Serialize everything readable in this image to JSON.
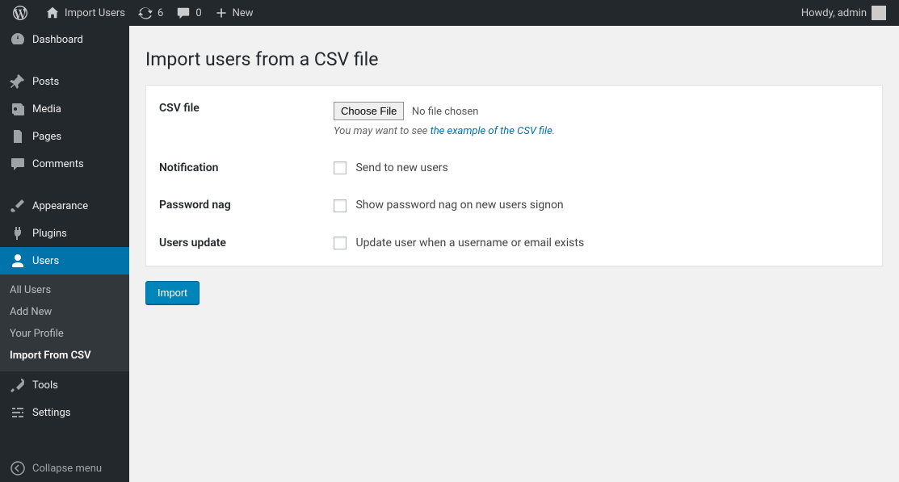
{
  "adminbar": {
    "site_title": "Import Users",
    "updates_count": "6",
    "comments_count": "0",
    "new_label": "New",
    "howdy": "Howdy, admin"
  },
  "sidebar": {
    "items": {
      "dashboard": "Dashboard",
      "posts": "Posts",
      "media": "Media",
      "pages": "Pages",
      "comments": "Comments",
      "appearance": "Appearance",
      "plugins": "Plugins",
      "users": "Users",
      "tools": "Tools",
      "settings": "Settings"
    },
    "users_submenu": {
      "all": "All Users",
      "add": "Add New",
      "profile": "Your Profile",
      "import": "Import From CSV"
    },
    "collapse": "Collapse menu"
  },
  "page": {
    "title": "Import users from a CSV file",
    "rows": {
      "csv_label": "CSV file",
      "choose_file": "Choose File",
      "no_file": "No file chosen",
      "help_prefix": "You may want to see ",
      "help_link": "the example of the CSV file",
      "help_suffix": ".",
      "notification_label": "Notification",
      "notification_check": "Send to new users",
      "password_label": "Password nag",
      "password_check": "Show password nag on new users signon",
      "update_label": "Users update",
      "update_check": "Update user when a username or email exists"
    },
    "submit": "Import"
  }
}
